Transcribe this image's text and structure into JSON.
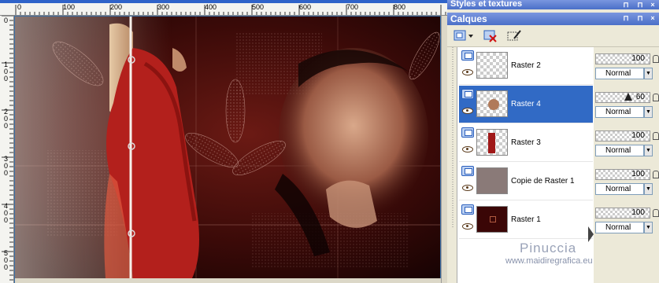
{
  "rulers": {
    "horizontal": [
      "0",
      "100",
      "200",
      "300",
      "400",
      "500",
      "600",
      "700",
      "800"
    ],
    "vertical": [
      "0",
      "1\n0\n0",
      "1\n5\n0",
      "2\n0\n0",
      "2\n5\n0",
      "3\n0\n0",
      "3\n5\n0",
      "4\n0\n0",
      "4\n5\n0",
      "5\n0\n0"
    ]
  },
  "styles_panel": {
    "title": "Styles et textures"
  },
  "layers_panel": {
    "title": "Calques",
    "layers": [
      {
        "name": "Raster 2",
        "opacity": "100",
        "blend": "Normal",
        "selected": false
      },
      {
        "name": "Raster 4",
        "opacity": "60",
        "blend": "Normal",
        "selected": true
      },
      {
        "name": "Raster 3",
        "opacity": "100",
        "blend": "Normal",
        "selected": false
      },
      {
        "name": "Copie de Raster 1",
        "opacity": "100",
        "blend": "Normal",
        "selected": false
      },
      {
        "name": "Raster 1",
        "opacity": "100",
        "blend": "Normal",
        "selected": false
      }
    ]
  },
  "watermark": {
    "text": "Pinuccia",
    "url": "www.maidiregrafica.eu"
  },
  "colors": {
    "panel_title": "#4a6fc8",
    "selection": "#316ac5",
    "canvas_dark": "#2a0606",
    "dress_red": "#c0201e"
  }
}
